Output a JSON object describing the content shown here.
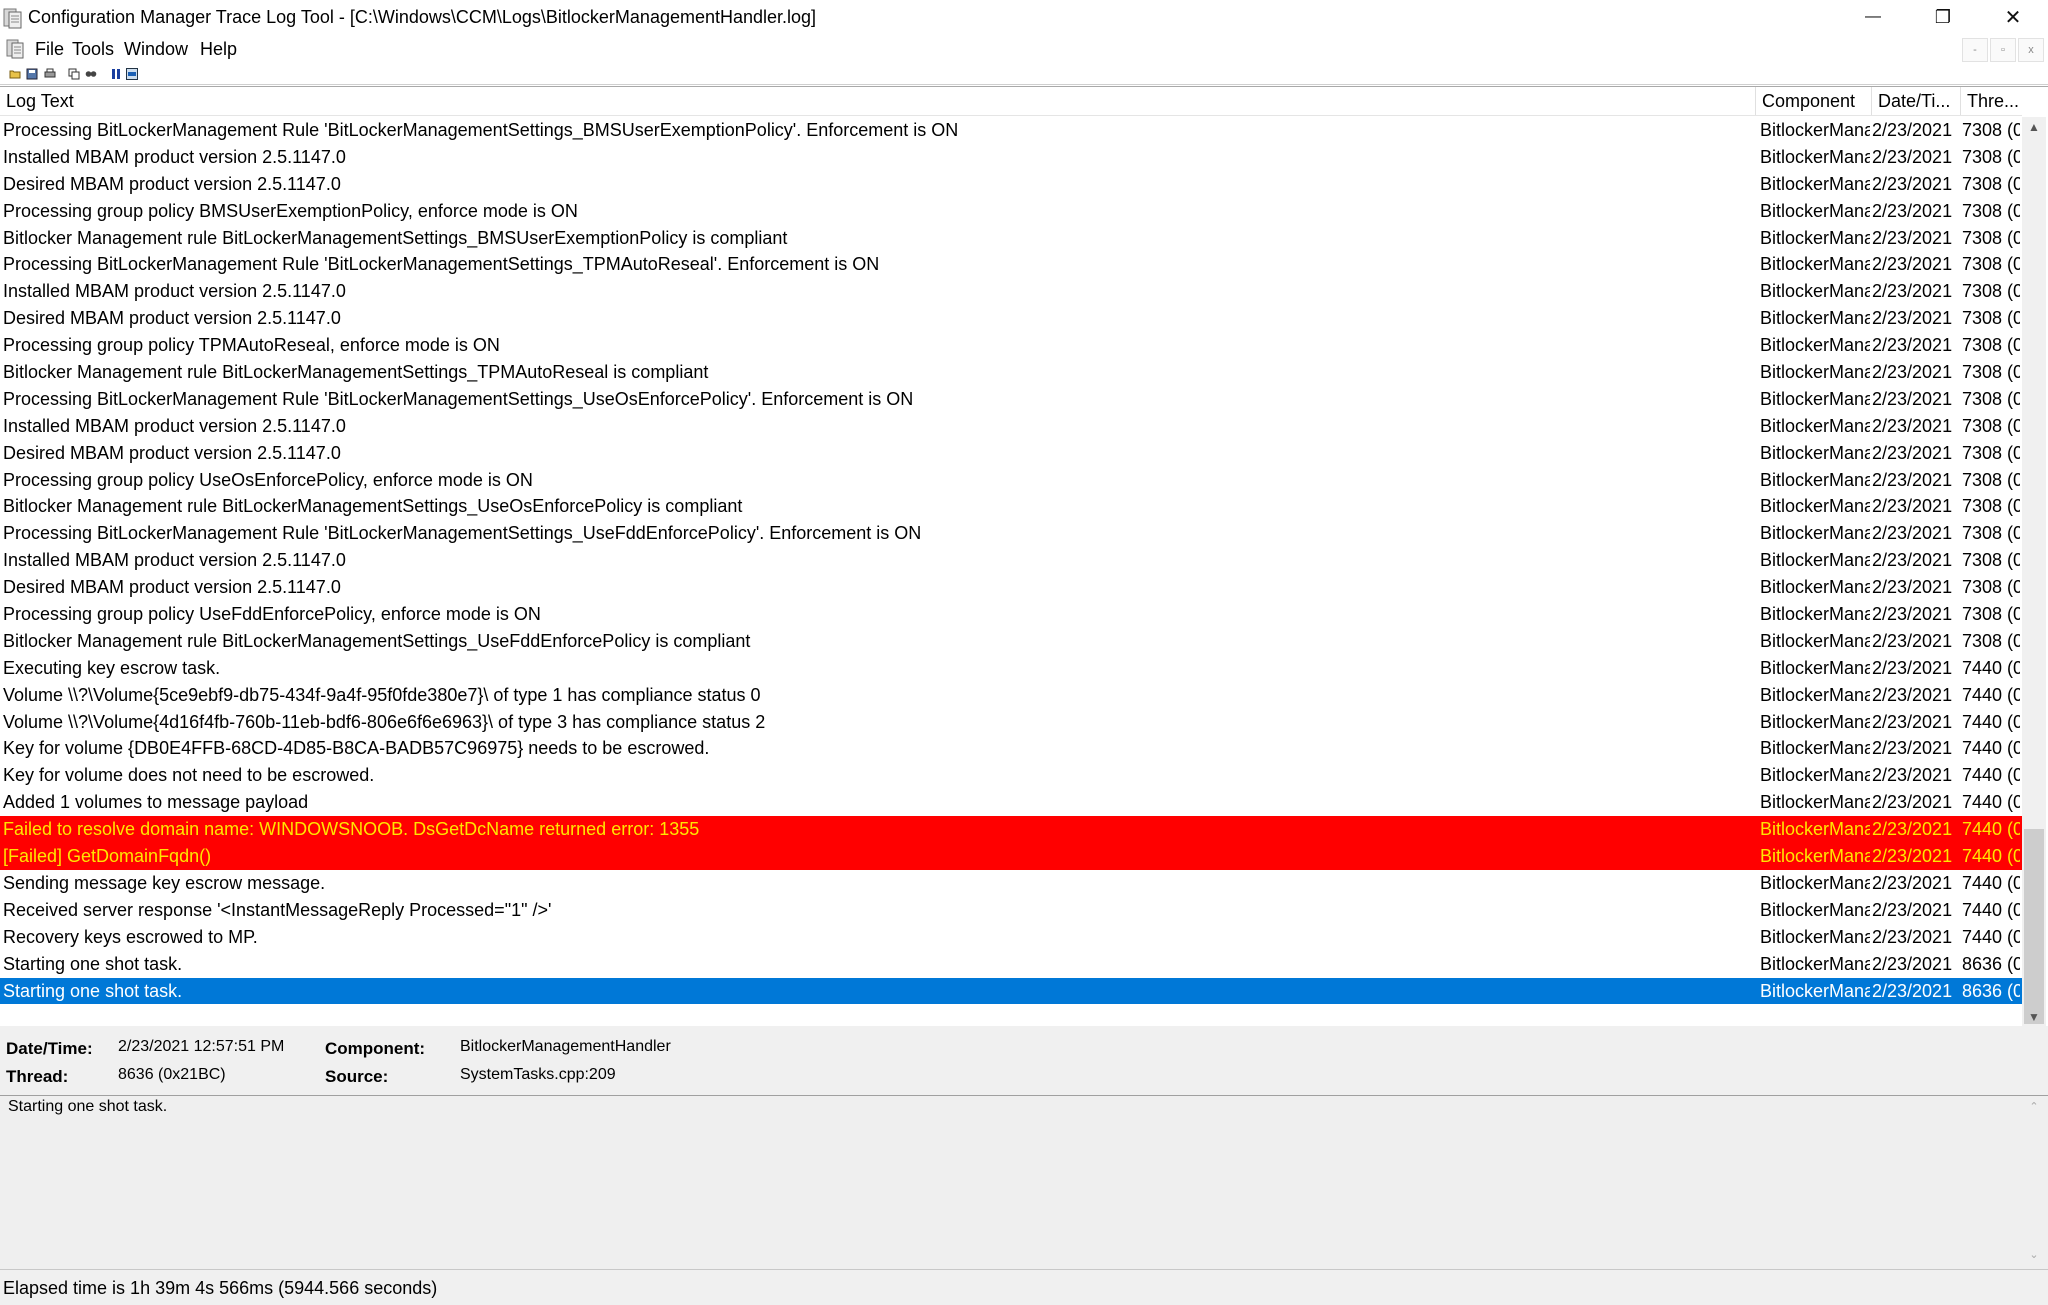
{
  "window": {
    "title": "Configuration Manager Trace Log Tool - [C:\\Windows\\CCM\\Logs\\BitlockerManagementHandler.log]",
    "minimize_glyph": "—",
    "restore_glyph": "❐",
    "close_glyph": "✕"
  },
  "menu": {
    "items": [
      "File",
      "Tools",
      "Window",
      "Help"
    ],
    "mdi_minimize": "-",
    "mdi_restore": "▫",
    "mdi_close": "x"
  },
  "toolbar": {
    "icons": [
      "open-icon",
      "save-icon",
      "print-icon",
      "copy-icon",
      "find-icon",
      "pause-icon",
      "highlight-icon"
    ]
  },
  "columns": {
    "log_text": "Log Text",
    "component": "Component",
    "datetime": "Date/Ti...",
    "thread": "Thre..."
  },
  "rows": [
    {
      "text": "Processing BitLockerManagement Rule 'BitLockerManagementSettings_BMSUserExemptionPolicy'. Enforcement is ON",
      "component": "BitlockerMana",
      "date": "2/23/2021",
      "thread": "7308 (0",
      "style": "normal"
    },
    {
      "text": "Installed MBAM product version 2.5.1147.0",
      "component": "BitlockerMana",
      "date": "2/23/2021",
      "thread": "7308 (0",
      "style": "normal"
    },
    {
      "text": "Desired MBAM product version 2.5.1147.0",
      "component": "BitlockerMana",
      "date": "2/23/2021",
      "thread": "7308 (0",
      "style": "normal"
    },
    {
      "text": "Processing group policy BMSUserExemptionPolicy, enforce mode is ON",
      "component": "BitlockerMana",
      "date": "2/23/2021",
      "thread": "7308 (0",
      "style": "normal"
    },
    {
      "text": "Bitlocker Management rule BitLockerManagementSettings_BMSUserExemptionPolicy is compliant",
      "component": "BitlockerMana",
      "date": "2/23/2021",
      "thread": "7308 (0",
      "style": "normal"
    },
    {
      "text": "Processing BitLockerManagement Rule 'BitLockerManagementSettings_TPMAutoReseal'. Enforcement is ON",
      "component": "BitlockerMana",
      "date": "2/23/2021",
      "thread": "7308 (0",
      "style": "normal"
    },
    {
      "text": "Installed MBAM product version 2.5.1147.0",
      "component": "BitlockerMana",
      "date": "2/23/2021",
      "thread": "7308 (0",
      "style": "normal"
    },
    {
      "text": "Desired MBAM product version 2.5.1147.0",
      "component": "BitlockerMana",
      "date": "2/23/2021",
      "thread": "7308 (0",
      "style": "normal"
    },
    {
      "text": "Processing group policy TPMAutoReseal, enforce mode is ON",
      "component": "BitlockerMana",
      "date": "2/23/2021",
      "thread": "7308 (0",
      "style": "normal"
    },
    {
      "text": "Bitlocker Management rule BitLockerManagementSettings_TPMAutoReseal is compliant",
      "component": "BitlockerMana",
      "date": "2/23/2021",
      "thread": "7308 (0",
      "style": "normal"
    },
    {
      "text": "Processing BitLockerManagement Rule 'BitLockerManagementSettings_UseOsEnforcePolicy'. Enforcement is ON",
      "component": "BitlockerMana",
      "date": "2/23/2021",
      "thread": "7308 (0",
      "style": "normal"
    },
    {
      "text": "Installed MBAM product version 2.5.1147.0",
      "component": "BitlockerMana",
      "date": "2/23/2021",
      "thread": "7308 (0",
      "style": "normal"
    },
    {
      "text": "Desired MBAM product version 2.5.1147.0",
      "component": "BitlockerMana",
      "date": "2/23/2021",
      "thread": "7308 (0",
      "style": "normal"
    },
    {
      "text": "Processing group policy UseOsEnforcePolicy, enforce mode is ON",
      "component": "BitlockerMana",
      "date": "2/23/2021",
      "thread": "7308 (0",
      "style": "normal"
    },
    {
      "text": "Bitlocker Management rule BitLockerManagementSettings_UseOsEnforcePolicy is compliant",
      "component": "BitlockerMana",
      "date": "2/23/2021",
      "thread": "7308 (0",
      "style": "normal"
    },
    {
      "text": "Processing BitLockerManagement Rule 'BitLockerManagementSettings_UseFddEnforcePolicy'. Enforcement is ON",
      "component": "BitlockerMana",
      "date": "2/23/2021",
      "thread": "7308 (0",
      "style": "normal"
    },
    {
      "text": "Installed MBAM product version 2.5.1147.0",
      "component": "BitlockerMana",
      "date": "2/23/2021",
      "thread": "7308 (0",
      "style": "normal"
    },
    {
      "text": "Desired MBAM product version 2.5.1147.0",
      "component": "BitlockerMana",
      "date": "2/23/2021",
      "thread": "7308 (0",
      "style": "normal"
    },
    {
      "text": "Processing group policy UseFddEnforcePolicy, enforce mode is ON",
      "component": "BitlockerMana",
      "date": "2/23/2021",
      "thread": "7308 (0",
      "style": "normal"
    },
    {
      "text": "Bitlocker Management rule BitLockerManagementSettings_UseFddEnforcePolicy is compliant",
      "component": "BitlockerMana",
      "date": "2/23/2021",
      "thread": "7308 (0",
      "style": "normal"
    },
    {
      "text": "Executing key escrow task.",
      "component": "BitlockerMana",
      "date": "2/23/2021",
      "thread": "7440 (0",
      "style": "normal"
    },
    {
      "text": "Volume \\\\?\\Volume{5ce9ebf9-db75-434f-9a4f-95f0fde380e7}\\ of type 1 has compliance status 0",
      "component": "BitlockerMana",
      "date": "2/23/2021",
      "thread": "7440 (0",
      "style": "normal"
    },
    {
      "text": "Volume \\\\?\\Volume{4d16f4fb-760b-11eb-bdf6-806e6f6e6963}\\ of type 3 has compliance status 2",
      "component": "BitlockerMana",
      "date": "2/23/2021",
      "thread": "7440 (0",
      "style": "normal"
    },
    {
      "text": "Key for volume {DB0E4FFB-68CD-4D85-B8CA-BADB57C96975} needs to be escrowed.",
      "component": "BitlockerMana",
      "date": "2/23/2021",
      "thread": "7440 (0",
      "style": "normal"
    },
    {
      "text": "Key for volume  does not need to be escrowed.",
      "component": "BitlockerMana",
      "date": "2/23/2021",
      "thread": "7440 (0",
      "style": "normal"
    },
    {
      "text": "Added 1 volumes to message payload",
      "component": "BitlockerMana",
      "date": "2/23/2021",
      "thread": "7440 (0",
      "style": "normal"
    },
    {
      "text": "Failed to resolve domain name: WINDOWSNOOB.  DsGetDcName returned error: 1355",
      "component": "BitlockerMana",
      "date": "2/23/2021",
      "thread": "7440 (0",
      "style": "error"
    },
    {
      "text": "[Failed] GetDomainFqdn()",
      "component": "BitlockerMana",
      "date": "2/23/2021",
      "thread": "7440 (0",
      "style": "error"
    },
    {
      "text": "Sending message key escrow message.",
      "component": "BitlockerMana",
      "date": "2/23/2021",
      "thread": "7440 (0",
      "style": "normal"
    },
    {
      "text": "Received server response '<InstantMessageReply Processed=\"1\" />'",
      "component": "BitlockerMana",
      "date": "2/23/2021",
      "thread": "7440 (0",
      "style": "normal"
    },
    {
      "text": "Recovery keys escrowed to MP.",
      "component": "BitlockerMana",
      "date": "2/23/2021",
      "thread": "7440 (0",
      "style": "normal"
    },
    {
      "text": "Starting one shot task.",
      "component": "BitlockerMana",
      "date": "2/23/2021",
      "thread": "8636 (0",
      "style": "normal"
    },
    {
      "text": "Starting one shot task.",
      "component": "BitlockerMana",
      "date": "2/23/2021",
      "thread": "8636 (0",
      "style": "selected"
    }
  ],
  "details": {
    "datetime_label": "Date/Time:",
    "datetime_value": "2/23/2021 12:57:51 PM",
    "component_label": "Component:",
    "component_value": "BitlockerManagementHandler",
    "thread_label": "Thread:",
    "thread_value": "8636 (0x21BC)",
    "source_label": "Source:",
    "source_value": "SystemTasks.cpp:209",
    "message": "Starting one shot task."
  },
  "status": {
    "text": "Elapsed time is 1h 39m 4s 566ms (5944.566 seconds)"
  },
  "colors": {
    "error_bg": "#ff0000",
    "error_text": "#ffe600",
    "selected_bg": "#0078d7",
    "selected_text": "#ffffff"
  }
}
